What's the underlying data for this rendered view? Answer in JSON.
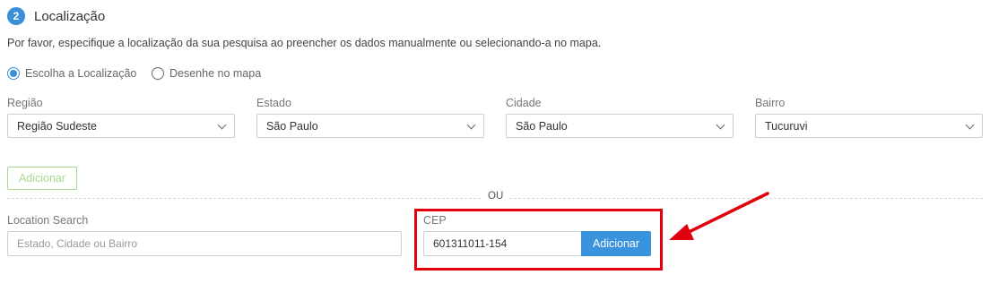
{
  "section": {
    "step": "2",
    "title": "Localização"
  },
  "description": "Por favor, especifique a localização da sua pesquisa ao preencher os dados manualmente ou selecionando-a no mapa.",
  "radios": [
    {
      "label": "Escolha a Localização",
      "checked": true
    },
    {
      "label": "Desenhe no mapa",
      "checked": false
    }
  ],
  "selects": [
    {
      "label": "Região",
      "value": "Região Sudeste"
    },
    {
      "label": "Estado",
      "value": "São Paulo"
    },
    {
      "label": "Cidade",
      "value": "São Paulo"
    },
    {
      "label": "Bairro",
      "value": "Tucuruvi"
    }
  ],
  "add_button": "Adicionar",
  "divider_text": "OU",
  "location_search": {
    "label": "Location Search",
    "placeholder": "Estado, Cidade ou Bairro"
  },
  "cep": {
    "label": "CEP",
    "value": "601311011-154",
    "button": "Adicionar"
  },
  "colors": {
    "accent": "#3a8fd8",
    "highlight": "#e0000e",
    "add_outline": "#a8d88e"
  }
}
